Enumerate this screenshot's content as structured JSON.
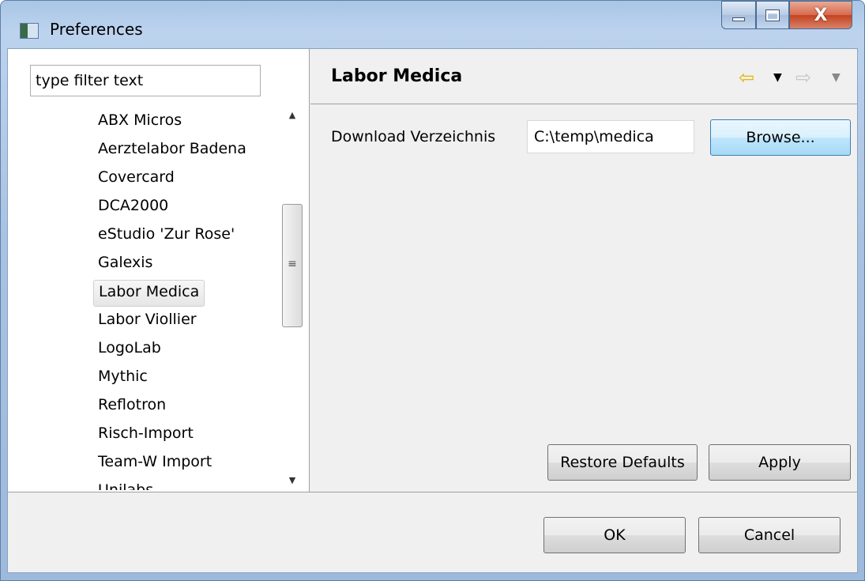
{
  "window": {
    "title": "Preferences"
  },
  "title_buttons": {
    "close_glyph": "X"
  },
  "filter": {
    "value": "type filter text"
  },
  "tree": {
    "items": [
      {
        "label": "ABX Micros",
        "selected": false
      },
      {
        "label": "Aerztelabor Badena",
        "selected": false
      },
      {
        "label": "Covercard",
        "selected": false
      },
      {
        "label": "DCA2000",
        "selected": false
      },
      {
        "label": "eStudio 'Zur Rose'",
        "selected": false
      },
      {
        "label": "Galexis",
        "selected": false
      },
      {
        "label": "Labor Medica",
        "selected": true
      },
      {
        "label": "Labor Viollier",
        "selected": false
      },
      {
        "label": "LogoLab",
        "selected": false
      },
      {
        "label": "Mythic",
        "selected": false
      },
      {
        "label": "Reflotron",
        "selected": false
      },
      {
        "label": "Risch-Import",
        "selected": false
      },
      {
        "label": "Team-W Import",
        "selected": false
      },
      {
        "label": "Unilabs",
        "selected": false
      }
    ]
  },
  "page": {
    "title": "Labor Medica",
    "nav_back_icon": "back-arrow-icon",
    "nav_forward_icon": "forward-arrow-icon"
  },
  "settings": {
    "download_label": "Download Verzeichnis",
    "download_value": "C:\\temp\\medica",
    "browse_label": "Browse..."
  },
  "page_buttons": {
    "restore_label": "Restore Defaults",
    "apply_label": "Apply"
  },
  "dialog_buttons": {
    "ok_label": "OK",
    "cancel_label": "Cancel"
  },
  "colors": {
    "titlebar": "#bcd3ee",
    "close_button": "#c3421f",
    "back_arrow": "#e8b400",
    "selection": "#e6e6e6",
    "browse_focus": "#3c7fb1"
  }
}
